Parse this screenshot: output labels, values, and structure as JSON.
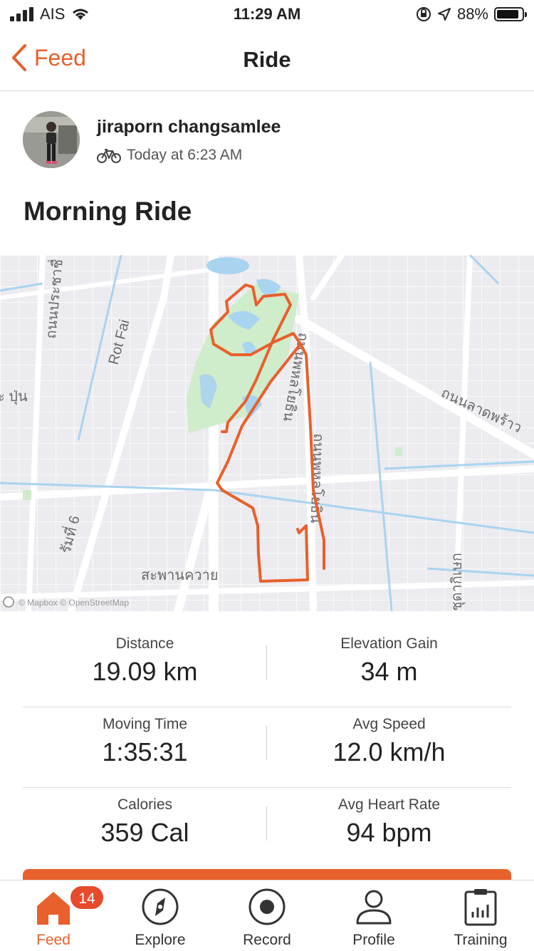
{
  "status_bar": {
    "carrier": "AIS",
    "time": "11:29 AM",
    "battery_percent": "88%",
    "battery_level": 0.88
  },
  "nav": {
    "back_label": "Feed",
    "title": "Ride"
  },
  "athlete": {
    "name": "jiraporn changsamlee",
    "timestamp": "Today at 6:23 AM",
    "activity_icon": "bicycle-icon"
  },
  "activity": {
    "title": "Morning Ride"
  },
  "map": {
    "labels": {
      "road_1": "ถนนประชาชื่",
      "road_2": "Rot Fai",
      "road_3": "ถนนลาดพร้าว",
      "road_4": "สะพานควาย",
      "road_5": "ชุดากิเษก",
      "road_6": "ะ ปุ่น",
      "road_7": "รัมที่ 6",
      "road_8": "ถนนพหลโยธิน",
      "road_9": "ถนนพหลโยธิน"
    },
    "attribution": "© Mapbox © OpenStreetMap",
    "route_color": "#e8602c",
    "park_color": "#cfeccb",
    "water_color": "#a9d4f0"
  },
  "stats": [
    {
      "left": {
        "label": "Distance",
        "value": "19.09 km"
      },
      "right": {
        "label": "Elevation Gain",
        "value": "34 m"
      }
    },
    {
      "left": {
        "label": "Moving Time",
        "value": "1:35:31"
      },
      "right": {
        "label": "Avg Speed",
        "value": "12.0 km/h"
      }
    },
    {
      "left": {
        "label": "Calories",
        "value": "359 Cal"
      },
      "right": {
        "label": "Avg Heart Rate",
        "value": "94 bpm"
      }
    }
  ],
  "tabs": [
    {
      "label": "Feed",
      "icon": "home-icon",
      "badge": "14",
      "active": true
    },
    {
      "label": "Explore",
      "icon": "compass-icon"
    },
    {
      "label": "Record",
      "icon": "record-icon"
    },
    {
      "label": "Profile",
      "icon": "profile-icon"
    },
    {
      "label": "Training",
      "icon": "training-icon"
    }
  ],
  "colors": {
    "accent": "#e8602c"
  }
}
